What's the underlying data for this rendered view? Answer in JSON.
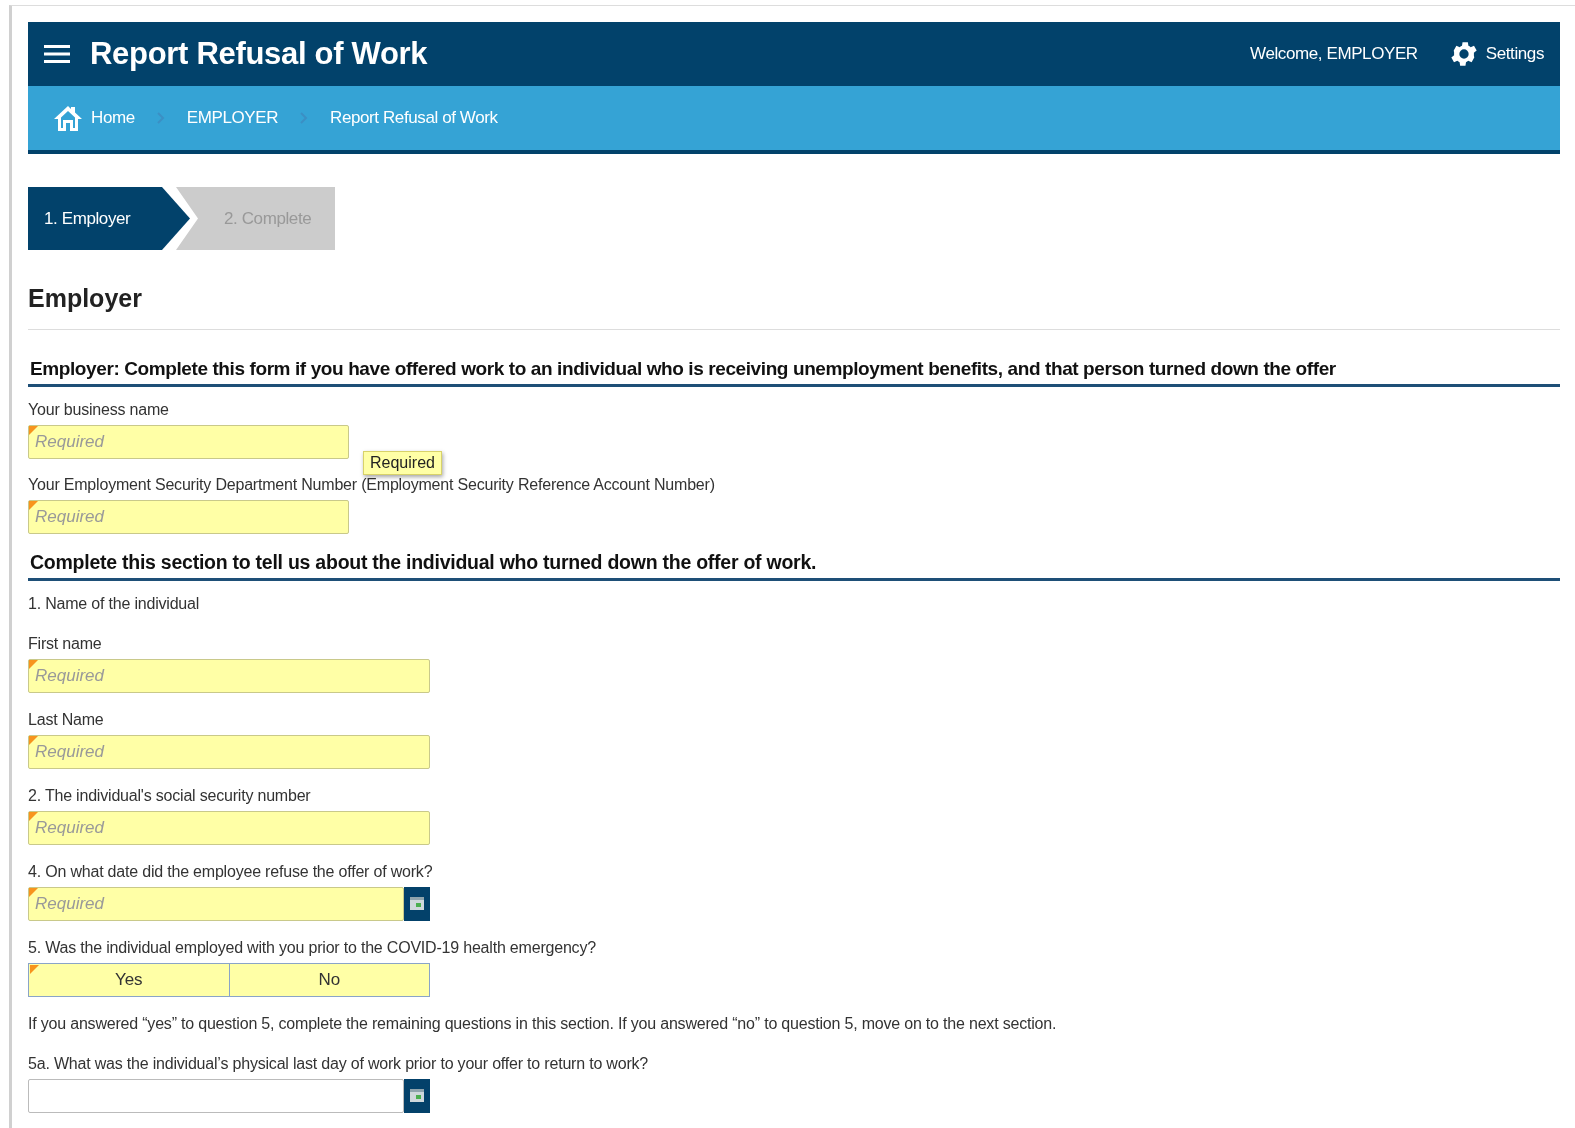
{
  "header": {
    "title": "Report Refusal of Work",
    "welcome": "Welcome, EMPLOYER",
    "settings": "Settings"
  },
  "breadcrumb": [
    {
      "label": "Home",
      "kind": "home"
    },
    {
      "label": "EMPLOYER",
      "kind": "link"
    },
    {
      "label": "Report Refusal of Work",
      "kind": "link"
    }
  ],
  "steps": [
    {
      "label": "1. Employer",
      "selected": true
    },
    {
      "label": "2. Complete",
      "selected": false
    }
  ],
  "page_title": "Employer",
  "sections": [
    {
      "heading": "Employer: Complete this form if you have offered work to an individual who is receiving unemployment benefits, and that person turned down the offer",
      "items": [
        {
          "kind": "field",
          "label": "Your business name",
          "placeholder": "Required",
          "required": true,
          "tooltip": "Required"
        },
        {
          "kind": "field",
          "label": "Your Employment Security Department Number (Employment Security Reference Account Number)",
          "placeholder": "Required",
          "required": true
        }
      ]
    },
    {
      "heading": "Complete this section to tell us about the individual who turned down the offer of work.",
      "items": [
        {
          "kind": "text",
          "text": "1. Name of the individual"
        },
        {
          "kind": "field",
          "label": "First name",
          "placeholder": "Required",
          "required": true
        },
        {
          "kind": "field",
          "label": "Last Name",
          "placeholder": "Required",
          "required": true
        },
        {
          "kind": "field",
          "label": "2. The individual's social security number",
          "placeholder": "Required",
          "required": true
        },
        {
          "kind": "date",
          "label": "4. On what date did the employee refuse the offer of work?",
          "placeholder": "Required",
          "required": true
        },
        {
          "kind": "toggle",
          "label": "5. Was the individual employed with you prior to the COVID-19 health emergency?",
          "required": true,
          "options": [
            {
              "label": "Yes",
              "selected": false
            },
            {
              "label": "No",
              "selected": false
            }
          ]
        },
        {
          "kind": "text",
          "text": "If you answered “yes” to question 5, complete the remaining questions in this section. If you answered “no” to question 5, move on to the next section."
        },
        {
          "kind": "date",
          "label": "5a. What was the individual’s physical last day of work prior to your offer to return to work?",
          "required": false
        }
      ]
    }
  ]
}
